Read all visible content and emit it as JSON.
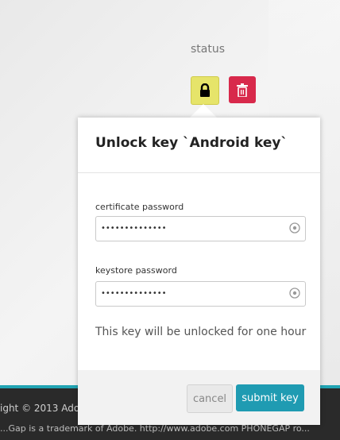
{
  "page": {
    "status_label": "status",
    "footer": {
      "copyright": "ight © 2013 Adobe",
      "trademark": "...Gap is a trademark of Adobe. http://www.adobe.com PHONEGAP ro..."
    }
  },
  "icons": {
    "lock": "lock-icon",
    "trash": "trash-icon",
    "reveal": "eye-icon"
  },
  "dialog": {
    "title": "Unlock key `Android key`",
    "certificate_label": "certificate password",
    "certificate_value": "••••••••••••••",
    "keystore_label": "keystore password",
    "keystore_value": "••••••••••••••",
    "message": "This key will be unlocked for one hour",
    "cancel_label": "cancel",
    "submit_label": "submit key"
  },
  "colors": {
    "accent": "#1f9bb2",
    "lock_button": "#e6e46a",
    "delete_button": "#d8294b",
    "footer_bg": "#2a2a2a",
    "footer_accent": "#21a4b3"
  }
}
